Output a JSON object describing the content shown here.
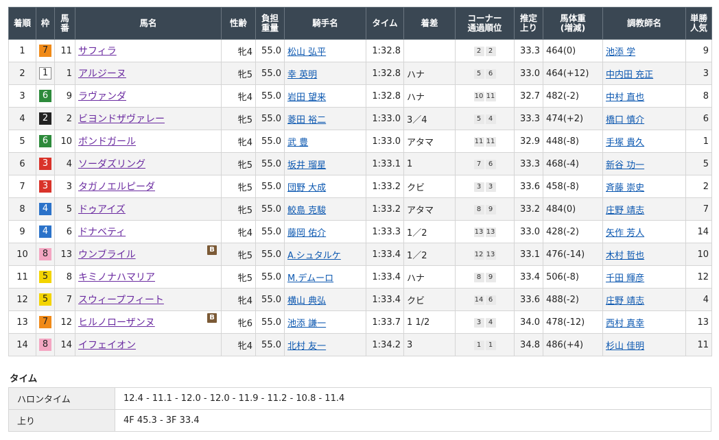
{
  "headers": {
    "rank": "着順",
    "waku": "枠",
    "umaban": "馬番",
    "horse": "馬名",
    "sexage": "性齢",
    "weight": "負担重量",
    "jockey": "騎手名",
    "time": "タイム",
    "margin": "着差",
    "corner": "コーナー通過順位",
    "last": "推定上り",
    "bodyweight": "馬体重(増減)",
    "trainer": "調教師名",
    "popularity": "単勝人気"
  },
  "rows": [
    {
      "rank": "1",
      "waku": "7",
      "umaban": "11",
      "horse": "サフィラ",
      "blinker": "",
      "sexage": "牝4",
      "weight": "55.0",
      "jockey": "松山 弘平",
      "time": "1:32.8",
      "margin": "",
      "corners": [
        "2",
        "2"
      ],
      "last": "33.3",
      "bodyweight": "464(0)",
      "trainer": "池添 学",
      "popularity": "9"
    },
    {
      "rank": "2",
      "waku": "1",
      "umaban": "1",
      "horse": "アルジーヌ",
      "blinker": "",
      "sexage": "牝5",
      "weight": "55.0",
      "jockey": "幸 英明",
      "time": "1:32.8",
      "margin": "ハナ",
      "corners": [
        "5",
        "6"
      ],
      "last": "33.0",
      "bodyweight": "464(+12)",
      "trainer": "中内田 充正",
      "popularity": "3"
    },
    {
      "rank": "3",
      "waku": "6",
      "umaban": "9",
      "horse": "ラヴァンダ",
      "blinker": "",
      "sexage": "牝4",
      "weight": "55.0",
      "jockey": "岩田 望来",
      "time": "1:32.8",
      "margin": "ハナ",
      "corners": [
        "10",
        "11"
      ],
      "last": "32.7",
      "bodyweight": "482(-2)",
      "trainer": "中村 直也",
      "popularity": "8"
    },
    {
      "rank": "4",
      "waku": "2",
      "umaban": "2",
      "horse": "ビヨンドザヴァレー",
      "blinker": "",
      "sexage": "牝5",
      "weight": "55.0",
      "jockey": "菱田 裕二",
      "time": "1:33.0",
      "margin": "3／4",
      "corners": [
        "5",
        "4"
      ],
      "last": "33.3",
      "bodyweight": "474(+2)",
      "trainer": "橋口 慎介",
      "popularity": "6"
    },
    {
      "rank": "5",
      "waku": "6",
      "umaban": "10",
      "horse": "ボンドガール",
      "blinker": "",
      "sexage": "牝4",
      "weight": "55.0",
      "jockey": "武 豊",
      "time": "1:33.0",
      "margin": "アタマ",
      "corners": [
        "11",
        "11"
      ],
      "last": "32.9",
      "bodyweight": "448(-8)",
      "trainer": "手塚 貴久",
      "popularity": "1"
    },
    {
      "rank": "6",
      "waku": "3",
      "umaban": "4",
      "horse": "ソーダズリング",
      "blinker": "",
      "sexage": "牝5",
      "weight": "55.0",
      "jockey": "坂井 瑠星",
      "time": "1:33.1",
      "margin": "1",
      "corners": [
        "7",
        "6"
      ],
      "last": "33.3",
      "bodyweight": "468(-4)",
      "trainer": "新谷 功一",
      "popularity": "5"
    },
    {
      "rank": "7",
      "waku": "3",
      "umaban": "3",
      "horse": "タガノエルピーダ",
      "blinker": "",
      "sexage": "牝5",
      "weight": "55.0",
      "jockey": "団野 大成",
      "time": "1:33.2",
      "margin": "クビ",
      "corners": [
        "3",
        "3"
      ],
      "last": "33.6",
      "bodyweight": "458(-8)",
      "trainer": "斉藤 崇史",
      "popularity": "2"
    },
    {
      "rank": "8",
      "waku": "4",
      "umaban": "5",
      "horse": "ドゥアイズ",
      "blinker": "",
      "sexage": "牝5",
      "weight": "55.0",
      "jockey": "鮫島 克駿",
      "time": "1:33.2",
      "margin": "アタマ",
      "corners": [
        "8",
        "9"
      ],
      "last": "33.2",
      "bodyweight": "484(0)",
      "trainer": "庄野 靖志",
      "popularity": "7"
    },
    {
      "rank": "9",
      "waku": "4",
      "umaban": "6",
      "horse": "ドナベティ",
      "blinker": "",
      "sexage": "牝4",
      "weight": "55.0",
      "jockey": "藤岡 佑介",
      "time": "1:33.3",
      "margin": "1／2",
      "corners": [
        "13",
        "13"
      ],
      "last": "33.0",
      "bodyweight": "428(-2)",
      "trainer": "矢作 芳人",
      "popularity": "14"
    },
    {
      "rank": "10",
      "waku": "8",
      "umaban": "13",
      "horse": "ウンブライル",
      "blinker": "B",
      "sexage": "牝5",
      "weight": "55.0",
      "jockey": "A.シュタルケ",
      "time": "1:33.4",
      "margin": "1／2",
      "corners": [
        "12",
        "13"
      ],
      "last": "33.1",
      "bodyweight": "476(-14)",
      "trainer": "木村 哲也",
      "popularity": "10"
    },
    {
      "rank": "11",
      "waku": "5",
      "umaban": "8",
      "horse": "キミノナハマリア",
      "blinker": "",
      "sexage": "牝5",
      "weight": "55.0",
      "jockey": "M.デムーロ",
      "time": "1:33.4",
      "margin": "ハナ",
      "corners": [
        "8",
        "9"
      ],
      "last": "33.4",
      "bodyweight": "506(-8)",
      "trainer": "千田 輝彦",
      "popularity": "12"
    },
    {
      "rank": "12",
      "waku": "5",
      "umaban": "7",
      "horse": "スウィープフィート",
      "blinker": "",
      "sexage": "牝4",
      "weight": "55.0",
      "jockey": "横山 典弘",
      "time": "1:33.4",
      "margin": "クビ",
      "corners": [
        "14",
        "6"
      ],
      "last": "33.6",
      "bodyweight": "488(-2)",
      "trainer": "庄野 靖志",
      "popularity": "4"
    },
    {
      "rank": "13",
      "waku": "7",
      "umaban": "12",
      "horse": "ヒルノローザンヌ",
      "blinker": "B",
      "sexage": "牝6",
      "weight": "55.0",
      "jockey": "池添 謙一",
      "time": "1:33.7",
      "margin": "1 1/2",
      "corners": [
        "3",
        "4"
      ],
      "last": "34.0",
      "bodyweight": "478(-12)",
      "trainer": "西村 真幸",
      "popularity": "13"
    },
    {
      "rank": "14",
      "waku": "8",
      "umaban": "14",
      "horse": "イフェイオン",
      "blinker": "",
      "sexage": "牝4",
      "weight": "55.0",
      "jockey": "北村 友一",
      "time": "1:34.2",
      "margin": "3",
      "corners": [
        "1",
        "1"
      ],
      "last": "34.8",
      "bodyweight": "486(+4)",
      "trainer": "杉山 佳明",
      "popularity": "11"
    }
  ],
  "time_section": {
    "heading": "タイム",
    "furlong_label": "ハロンタイム",
    "furlong_value": "12.4 - 11.1 - 12.0 - 12.0 - 11.9 - 11.2 - 10.8 - 11.4",
    "last_label": "上り",
    "last_value": "4F 45.3 - 3F 33.4"
  },
  "colors": {
    "header_bg": "#3a4753",
    "link": "#0b57b0",
    "horse_link": "#6a2aa0",
    "blinker_badge": "#7b5a36"
  }
}
